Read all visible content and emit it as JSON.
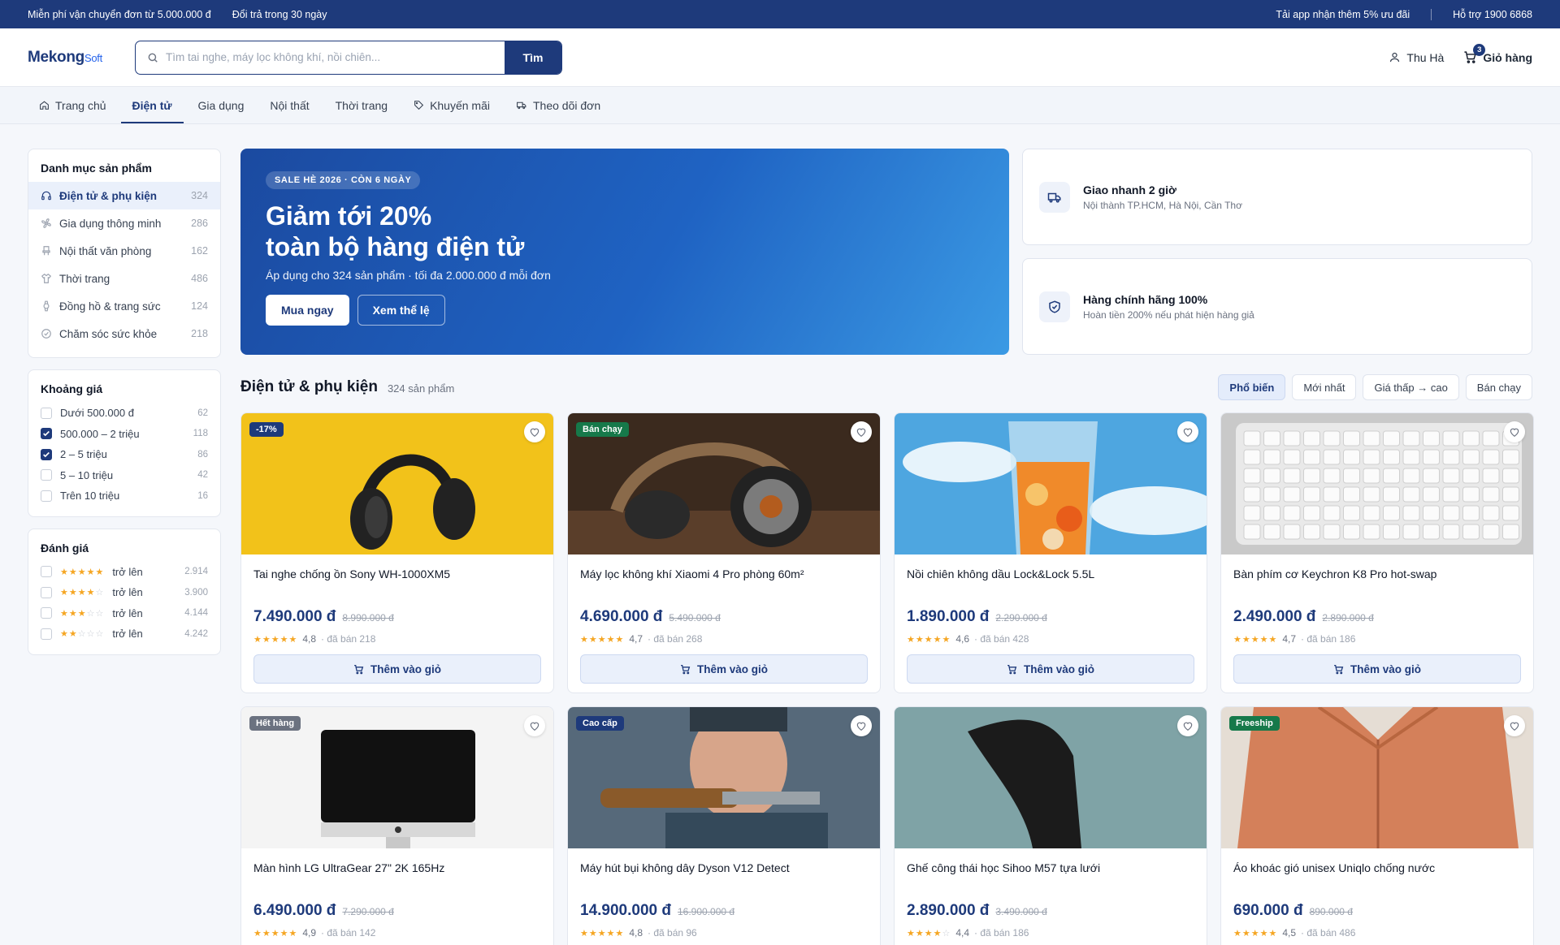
{
  "topbar": {
    "left": [
      "Miễn phí vận chuyển đơn từ 5.000.000 đ",
      "Đổi trả trong 30 ngày"
    ],
    "app_promo": "Tải app nhận thêm 5% ưu đãi",
    "hotline": "Hỗ trợ 1900 6868"
  },
  "header": {
    "logo_main": "Mekong",
    "logo_soft": "Soft",
    "search_placeholder": "Tìm tai nghe, máy lọc không khí, nồi chiên...",
    "search_button": "Tìm",
    "user_name": "Thu Hà",
    "cart_label": "Giỏ hàng",
    "cart_count": "3"
  },
  "nav": [
    {
      "label": "Trang chủ",
      "icon": "home-icon"
    },
    {
      "label": "Điện tử",
      "icon": ""
    },
    {
      "label": "Gia dụng",
      "icon": ""
    },
    {
      "label": "Nội thất",
      "icon": ""
    },
    {
      "label": "Thời trang",
      "icon": ""
    },
    {
      "label": "Khuyến mãi",
      "icon": "tag-icon"
    },
    {
      "label": "Theo dõi đơn",
      "icon": "truck-icon"
    }
  ],
  "nav_active": "Điện tử",
  "sidebar": {
    "categories_title": "Danh mục sản phẩm",
    "categories": [
      {
        "label": "Điện tử & phụ kiện",
        "count": "324",
        "icon": "headphones-icon",
        "active": true
      },
      {
        "label": "Gia dụng thông minh",
        "count": "286",
        "icon": "fan-icon",
        "active": false
      },
      {
        "label": "Nội thất văn phòng",
        "count": "162",
        "icon": "chair-icon",
        "active": false
      },
      {
        "label": "Thời trang",
        "count": "486",
        "icon": "shirt-icon",
        "active": false
      },
      {
        "label": "Đồng hồ & trang sức",
        "count": "124",
        "icon": "watch-icon",
        "active": false
      },
      {
        "label": "Chăm sóc sức khỏe",
        "count": "218",
        "icon": "check-circle-icon",
        "active": false
      }
    ],
    "price_title": "Khoảng giá",
    "prices": [
      {
        "label": "Dưới 500.000 đ",
        "count": "62",
        "checked": false
      },
      {
        "label": "500.000 – 2 triệu",
        "count": "118",
        "checked": true
      },
      {
        "label": "2 – 5 triệu",
        "count": "86",
        "checked": true
      },
      {
        "label": "5 – 10 triệu",
        "count": "42",
        "checked": false
      },
      {
        "label": "Trên 10 triệu",
        "count": "16",
        "checked": false
      }
    ],
    "rating_title": "Đánh giá",
    "ratings": [
      {
        "stars": 5,
        "label": "trở lên",
        "count": "2.914"
      },
      {
        "stars": 4,
        "label": "trở lên",
        "count": "3.900"
      },
      {
        "stars": 3,
        "label": "trở lên",
        "count": "4.144"
      },
      {
        "stars": 2,
        "label": "trở lên",
        "count": "4.242"
      }
    ]
  },
  "hero": {
    "tag": "SALE HÈ 2026 · CÒN 6 NGÀY",
    "title_line1": "Giảm tới 20%",
    "title_line2": "toàn bộ hàng điện tử",
    "subtitle": "Áp dụng cho 324 sản phẩm · tối đa 2.000.000 đ mỗi đơn",
    "primary_button": "Mua ngay",
    "secondary_button": "Xem thể lệ"
  },
  "perks": [
    {
      "title": "Giao nhanh 2 giờ",
      "subtitle": "Nội thành TP.HCM, Hà Nội, Cần Thơ",
      "icon": "truck-icon"
    },
    {
      "title": "Hàng chính hãng 100%",
      "subtitle": "Hoàn tiền 200% nếu phát hiện hàng giả",
      "icon": "shield-check-icon"
    }
  ],
  "section": {
    "title": "Điện tử & phụ kiện",
    "count": "324 sản phẩm",
    "sorts": [
      "Phổ biến",
      "Mới nhất",
      "Giá thấp → cao",
      "Bán chạy"
    ],
    "active_sort": "Phổ biến"
  },
  "add_to_cart": "Thêm vào giỏ",
  "products": [
    {
      "name": "Tai nghe chống ồn Sony WH-1000XM5",
      "price": "7.490.000 đ",
      "old_price": "8.990.000 đ",
      "rating": "4,8",
      "stars": 5,
      "sold": "đã bán 218",
      "badge": "-17%",
      "badge_color": "#1e3a7b",
      "image": "headphones-yellow"
    },
    {
      "name": "Máy lọc không khí Xiaomi 4 Pro phòng 60m²",
      "price": "4.690.000 đ",
      "old_price": "5.490.000 đ",
      "rating": "4,7",
      "stars": 5,
      "sold": "đã bán 268",
      "badge": "Bán chạy",
      "badge_color": "#16794a",
      "image": "headphones-dark"
    },
    {
      "name": "Nồi chiên không dầu Lock&Lock 5.5L",
      "price": "1.890.000 đ",
      "old_price": "2.290.000 đ",
      "rating": "4,6",
      "stars": 5,
      "sold": "đã bán 428",
      "badge": "",
      "badge_color": "",
      "image": "blender-fruit"
    },
    {
      "name": "Bàn phím cơ Keychron K8 Pro hot-swap",
      "price": "2.490.000 đ",
      "old_price": "2.890.000 đ",
      "rating": "4,7",
      "stars": 5,
      "sold": "đã bán 186",
      "badge": "",
      "badge_color": "",
      "image": "keyboard"
    },
    {
      "name": "Màn hình LG UltraGear 27\" 2K 165Hz",
      "price": "6.490.000 đ",
      "old_price": "7.290.000 đ",
      "rating": "4,9",
      "stars": 5,
      "sold": "đã bán 142",
      "badge": "Hết hàng",
      "badge_color": "#6b7280",
      "image": "monitor"
    },
    {
      "name": "Máy hút bụi không dây Dyson V12 Detect",
      "price": "14.900.000 đ",
      "old_price": "16.900.000 đ",
      "rating": "4,8",
      "stars": 5,
      "sold": "đã bán 96",
      "badge": "Cao cấp",
      "badge_color": "#1e3a7b",
      "image": "workshop"
    },
    {
      "name": "Ghế công thái học Sihoo M57 tựa lưới",
      "price": "2.890.000 đ",
      "old_price": "3.490.000 đ",
      "rating": "4,4",
      "stars": 4,
      "sold": "đã bán 186",
      "badge": "",
      "badge_color": "",
      "image": "chair"
    },
    {
      "name": "Áo khoác gió unisex Uniqlo chống nước",
      "price": "690.000 đ",
      "old_price": "890.000 đ",
      "rating": "4,5",
      "stars": 5,
      "sold": "đã bán 486",
      "badge": "Freeship",
      "badge_color": "#16794a",
      "image": "jacket"
    }
  ],
  "colors": {
    "primary": "#1e3a7b",
    "accent": "#2563eb",
    "star": "#f5a623"
  }
}
